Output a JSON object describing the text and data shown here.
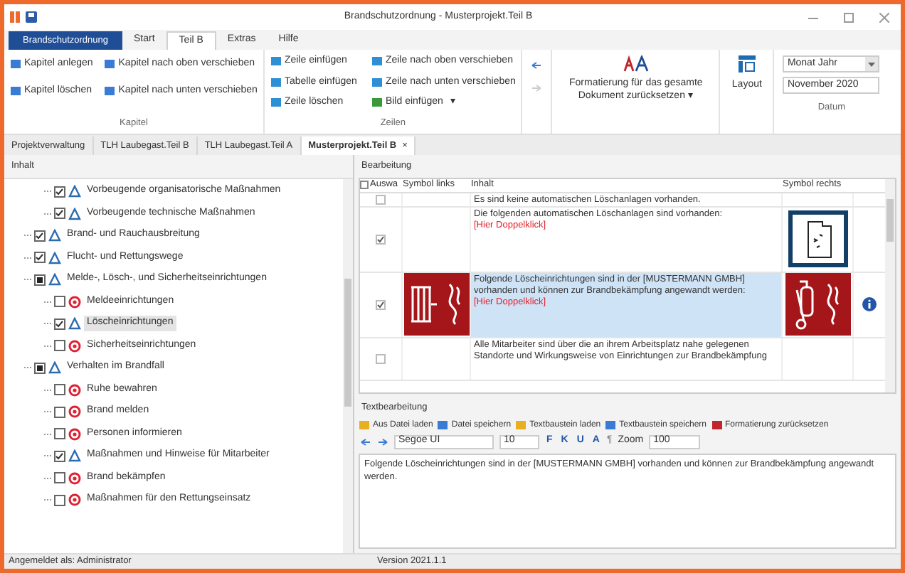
{
  "window": {
    "title": "Brandschutzordnung - Musterprojekt.Teil B"
  },
  "app_button": "Brandschutzordnung",
  "ribbon_tabs": [
    {
      "label": "Start",
      "selected": false
    },
    {
      "label": "Teil B",
      "selected": true
    },
    {
      "label": "Extras",
      "selected": false
    },
    {
      "label": "Hilfe",
      "selected": false
    }
  ],
  "ribbon": {
    "kapitel": {
      "label": "Kapitel",
      "col1": [
        "Kapitel anlegen",
        "Kapitel löschen"
      ],
      "col2": [
        "Kapitel nach oben verschieben",
        "Kapitel nach unten verschieben"
      ]
    },
    "zeilen": {
      "label": "Zeilen",
      "col1": [
        "Zeile einfügen",
        "Tabelle einfügen",
        "Zeile löschen"
      ],
      "col2": [
        "Zeile nach oben verschieben",
        "Zeile nach unten verschieben",
        "Bild einfügen"
      ],
      "dropdown_mark": "▾"
    },
    "format_button": "Formatierung für das gesamte Dokument zurücksetzen ▾",
    "layout_button": "Layout",
    "datum": {
      "label": "Datum",
      "format": "Monat Jahr",
      "value": "November 2020"
    }
  },
  "doc_tabs": [
    {
      "label": "Projektverwaltung",
      "selected": false,
      "closable": false
    },
    {
      "label": "TLH Laubegast.Teil B",
      "selected": false,
      "closable": false
    },
    {
      "label": "TLH Laubegast.Teil A",
      "selected": false,
      "closable": false
    },
    {
      "label": "Musterprojekt.Teil B",
      "selected": true,
      "closable": true
    }
  ],
  "close_glyph": "×",
  "tree": {
    "title": "Inhalt",
    "items": [
      {
        "children": [
          {
            "label": "Vorbeugende organisatorische Maßnahmen",
            "checked": true,
            "mixed": false,
            "selected": false
          },
          {
            "label": "Vorbeugende technische Maßnahmen",
            "checked": true,
            "mixed": false,
            "selected": false
          }
        ]
      },
      {
        "label": "Brand- und Rauchausbreitung",
        "checked": true,
        "mixed": false,
        "selected": false
      },
      {
        "label": "Flucht- und Rettungswege",
        "checked": true,
        "mixed": false,
        "selected": false
      },
      {
        "label": "Melde-, Lösch-, und Sicherheitseinrichtungen",
        "checked": true,
        "mixed": true,
        "selected": false,
        "children": [
          {
            "label": "Meldeeinrichtungen",
            "checked": false,
            "mixed": false,
            "selected": false
          },
          {
            "label": "Löscheinrichtungen",
            "checked": true,
            "mixed": false,
            "selected": true
          },
          {
            "label": "Sicherheitseinrichtungen",
            "checked": false,
            "mixed": false,
            "selected": false
          }
        ]
      },
      {
        "label": "Verhalten im Brandfall",
        "checked": true,
        "mixed": true,
        "selected": false,
        "children": [
          {
            "label": "Ruhe bewahren",
            "checked": false,
            "mixed": false,
            "selected": false
          },
          {
            "label": "Brand melden",
            "checked": false,
            "mixed": false,
            "selected": false
          },
          {
            "label": "Personen informieren",
            "checked": false,
            "mixed": false,
            "selected": false
          },
          {
            "label": "Maßnahmen und Hinweise für Mitarbeiter",
            "checked": true,
            "mixed": false,
            "selected": false
          },
          {
            "label": "Brand bekämpfen",
            "checked": false,
            "mixed": false,
            "selected": false
          },
          {
            "label": "Maßnahmen für den Rettungseinsatz",
            "checked": false,
            "mixed": false,
            "selected": false
          }
        ]
      }
    ]
  },
  "editor": {
    "title": "Bearbeitung",
    "columns": [
      "Auswa",
      "Symbol links",
      "Inhalt",
      "Symbol rechts"
    ],
    "header_checked": false,
    "rows": [
      {
        "checked": false,
        "text": "Es sind keine automatischen Löschanlagen vorhanden.",
        "selected": false,
        "info": false
      },
      {
        "checked": true,
        "text": "Die folgenden automatischen Löschanlagen sind vorhanden:",
        "link": "[Hier Doppelklick]",
        "right": {
          "kind": "extinguishing-system"
        },
        "selected": false,
        "info": false
      },
      {
        "checked": true,
        "text": "Folgende Löscheinrichtungen sind in der [MUSTERMANN GMBH] vorhanden und können zur Brandbekämpfung angewandt werden:",
        "link": "[Hier Doppelklick]",
        "left": {
          "kind": "fire-hose"
        },
        "right": {
          "kind": "extinguisher"
        },
        "info": true,
        "selected": true
      },
      {
        "checked": false,
        "text": "Alle Mitarbeiter sind über die an ihrem Arbeitsplatz nahe gelegenen Standorte und Wirkungsweise von Einrichtungen zur Brandbekämpfung",
        "selected": false,
        "info": false
      }
    ]
  },
  "text_editing": {
    "title": "Textbearbeitung",
    "actions": [
      "Aus Datei laden",
      "Datei speichern",
      "Textbaustein laden",
      "Textbaustein speichern",
      "Formatierung zurücksetzen"
    ],
    "font": "Segoe UI",
    "size": "10",
    "format_buttons": [
      "F",
      "K",
      "U",
      "A"
    ],
    "paragraph": "¶",
    "zoom_label": "Zoom",
    "zoom": "100",
    "content": "Folgende Löscheinrichtungen sind in der [MUSTERMANN GMBH] vorhanden und können zur Brandbekämpfung angewandt werden."
  },
  "status_bar": {
    "user": "Angemeldet als: Administrator",
    "version": "Version 2021.1.1"
  }
}
